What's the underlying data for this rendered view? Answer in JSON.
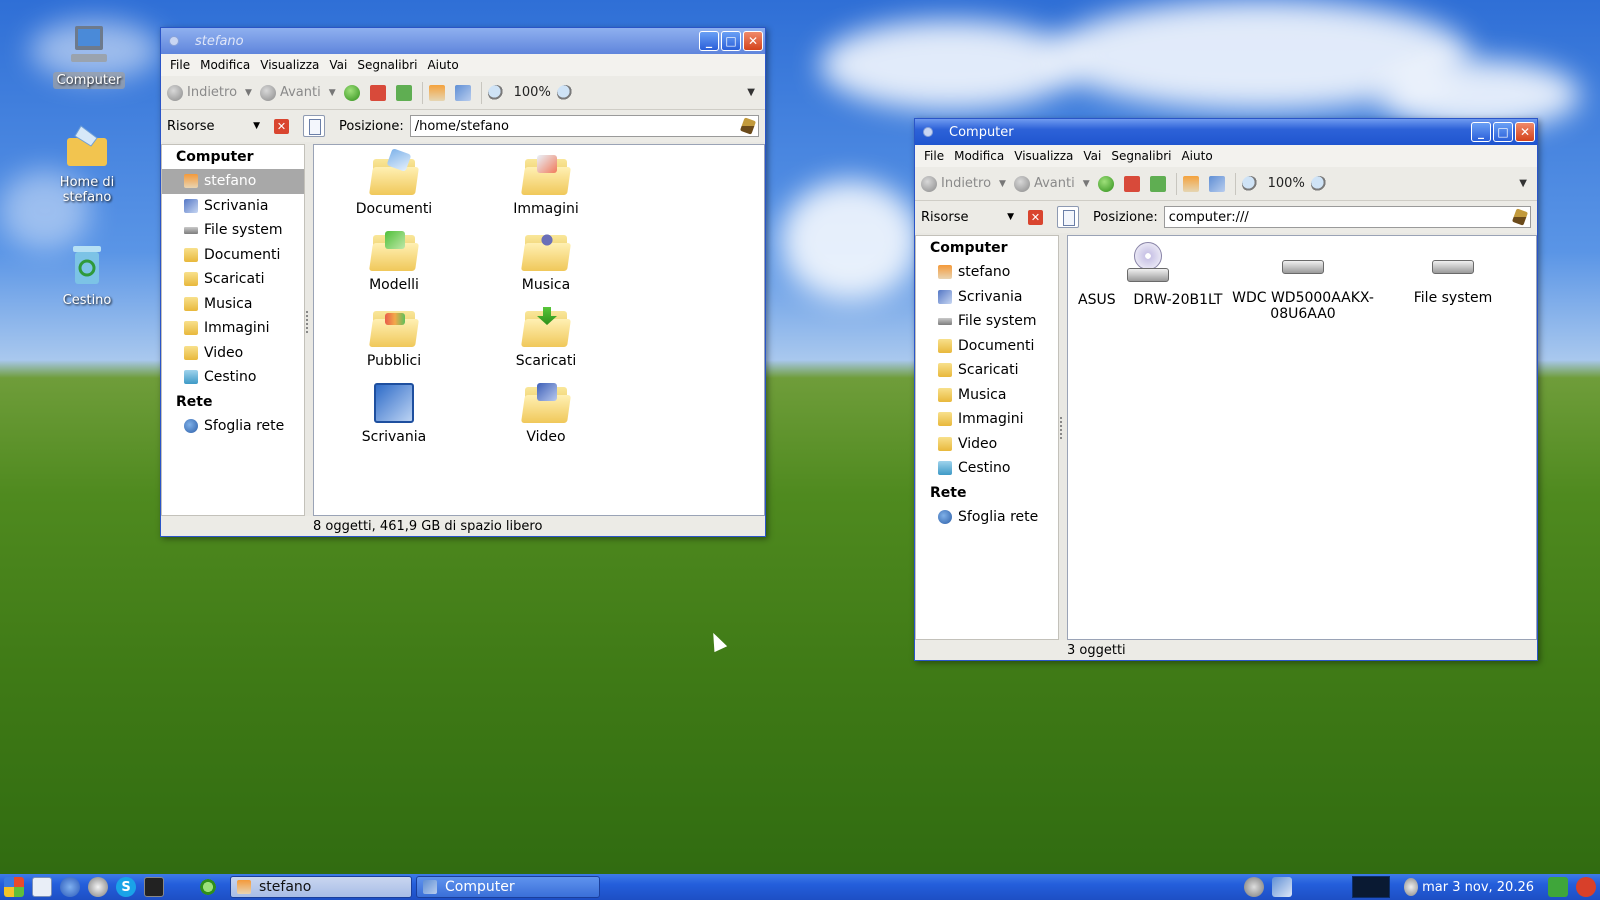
{
  "desktop": {
    "icons": [
      {
        "label": "Computer"
      },
      {
        "label": "Home di stefano"
      },
      {
        "label": "Cestino"
      }
    ]
  },
  "window_home": {
    "title": "stefano",
    "menu": [
      "File",
      "Modifica",
      "Visualizza",
      "Vai",
      "Segnalibri",
      "Aiuto"
    ],
    "toolbar": {
      "back": "Indietro",
      "forward": "Avanti",
      "zoom": "100%"
    },
    "side_header": "Risorse",
    "location_label": "Posizione:",
    "location_value": "/home/stefano",
    "sidebar": {
      "computer_header": "Computer",
      "items": [
        "stefano",
        "Scrivania",
        "File system",
        "Documenti",
        "Scaricati",
        "Musica",
        "Immagini",
        "Video",
        "Cestino"
      ],
      "network_header": "Rete",
      "network_items": [
        "Sfoglia rete"
      ]
    },
    "files": [
      "Documenti",
      "Immagini",
      "Modelli",
      "Musica",
      "Pubblici",
      "Scaricati",
      "Scrivania",
      "Video"
    ],
    "status": "8 oggetti, 461,9 GB di spazio libero"
  },
  "window_computer": {
    "title": "Computer",
    "menu": [
      "File",
      "Modifica",
      "Visualizza",
      "Vai",
      "Segnalibri",
      "Aiuto"
    ],
    "toolbar": {
      "back": "Indietro",
      "forward": "Avanti",
      "zoom": "100%"
    },
    "side_header": "Risorse",
    "location_label": "Posizione:",
    "location_value": "computer:///",
    "sidebar": {
      "computer_header": "Computer",
      "items": [
        "stefano",
        "Scrivania",
        "File system",
        "Documenti",
        "Scaricati",
        "Musica",
        "Immagini",
        "Video",
        "Cestino"
      ],
      "network_header": "Rete",
      "network_items": [
        "Sfoglia rete"
      ]
    },
    "files": [
      "ASUS    DRW-20B1LT",
      "WDC WD5000AAKX-08U6AA0",
      "File system"
    ],
    "status": "3 oggetti"
  },
  "taskbar": {
    "tasks": [
      "stefano",
      "Computer"
    ],
    "clock": "mar  3 nov, 20.26"
  }
}
